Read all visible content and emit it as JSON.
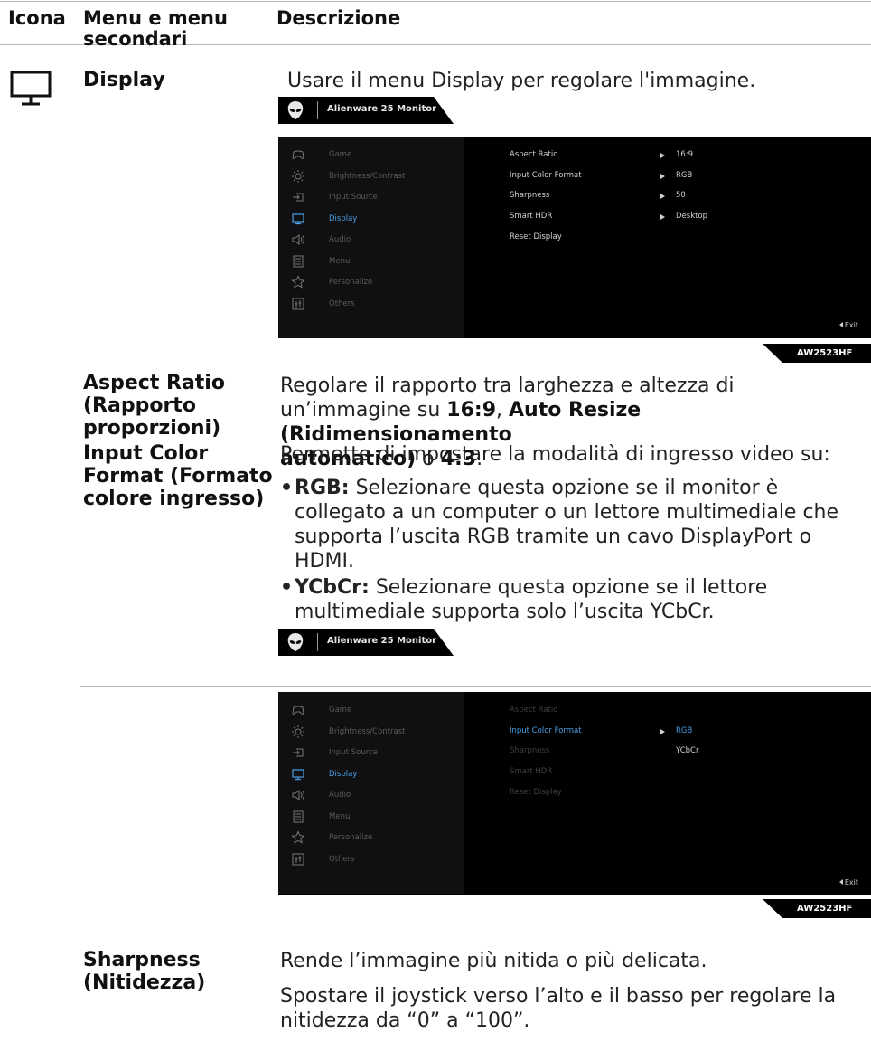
{
  "header": {
    "col_icon": "Icona",
    "col_menu_1": "Menu e menu",
    "col_menu_2": "secondari",
    "col_desc": "Descrizione"
  },
  "display": {
    "term": "Display",
    "desc": "Usare il menu Display per regolare l'immagine."
  },
  "osd": {
    "title": "Alienware 25 Monitor",
    "model": "AW2523HF",
    "exit": "Exit",
    "menu": [
      {
        "label": "Game",
        "icon": "gamepad-icon"
      },
      {
        "label": "Brightness/Contrast",
        "icon": "brightness-icon"
      },
      {
        "label": "Input Source",
        "icon": "input-source-icon"
      },
      {
        "label": "Display",
        "icon": "monitor-icon"
      },
      {
        "label": "Audio",
        "icon": "speaker-icon"
      },
      {
        "label": "Menu",
        "icon": "menu-list-icon"
      },
      {
        "label": "Personalize",
        "icon": "star-icon"
      },
      {
        "label": "Others",
        "icon": "others-icon"
      }
    ],
    "selected": "Display",
    "submenu": [
      {
        "label": "Aspect Ratio",
        "value": "16:9"
      },
      {
        "label": "Input Color Format",
        "value": "RGB"
      },
      {
        "label": "Sharpness",
        "value": "50"
      },
      {
        "label": "Smart HDR",
        "value": "Desktop"
      },
      {
        "label": "Reset Display"
      }
    ],
    "submenu2_options": [
      "RGB",
      "YCbCr"
    ],
    "submenu2_highlight": "Input Color Format"
  },
  "aspect": {
    "term_1": "Aspect Ratio",
    "term_2": "(Rapporto",
    "term_3": "proporzioni)",
    "line1": "Regolare il rapporto tra larghezza e altezza di",
    "line2_pre": "un’immagine su ",
    "line2_b1": "16:9",
    "line2_mid": ", ",
    "line2_b2": "Auto Resize (Ridimensionamento",
    "line3_b": "automatico)",
    "line3_mid": " o ",
    "line3_b2": "4:3",
    "line3_end": "."
  },
  "icf": {
    "term_1": "Input Color",
    "term_2": "Format (Formato",
    "term_3": "colore ingresso)",
    "intro": "Permette di impostare la modalità di ingresso video su:",
    "rgb_label": "RGB:",
    "rgb_l1": " Selezionare questa opzione se il monitor è",
    "rgb_l2": "collegato a un computer o un lettore multimediale che",
    "rgb_l3": "supporta l’uscita RGB tramite un cavo DisplayPort o",
    "rgb_l4": "HDMI.",
    "ycbcr_label": "YCbCr:",
    "ycbcr_l1": " Selezionare questa opzione se il lettore",
    "ycbcr_l2": "multimediale supporta solo l’uscita YCbCr."
  },
  "sharp": {
    "term_1": "Sharpness",
    "term_2": "(Nitidezza)",
    "line1": "Rende l’immagine più nitida o più delicata.",
    "line2": "Spostare il joystick verso l’alto e il basso per regolare la",
    "line3": "nitidezza da “0” a “100”."
  }
}
